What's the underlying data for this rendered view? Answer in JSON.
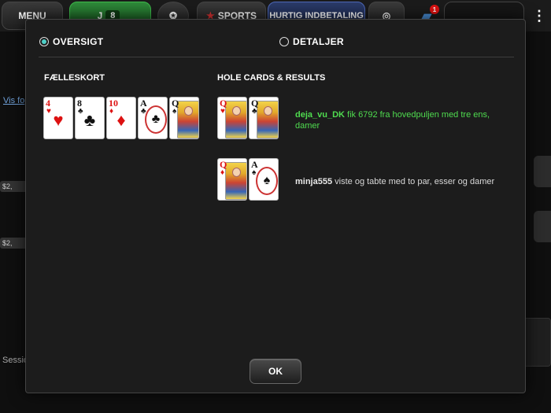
{
  "topbar": {
    "menu_label": "MENU",
    "hands_count": "8",
    "sports_label": "SPORTS",
    "quick_deposit_label": "HURTIG INDBETALING",
    "bag_badge": "1",
    "more_icon": "vertical-dots-icon"
  },
  "background": {
    "link_text": "Vis fo",
    "session_label": "Session",
    "chips": [
      "$2,",
      "$2,"
    ]
  },
  "modal": {
    "tabs": [
      {
        "label": "OVERSIGT",
        "selected": true
      },
      {
        "label": "DETALJER",
        "selected": false
      }
    ],
    "board_heading": "FÆLLESKORT",
    "hole_heading": "HOLE CARDS & RESULTS",
    "board_cards": [
      {
        "rank": "4",
        "suit": "♥",
        "color": "red"
      },
      {
        "rank": "8",
        "suit": "♣",
        "color": "black"
      },
      {
        "rank": "10",
        "suit": "♦",
        "color": "red"
      },
      {
        "rank": "A",
        "suit": "♣",
        "color": "black"
      },
      {
        "rank": "Q",
        "suit": "♠",
        "color": "black"
      }
    ],
    "hands": [
      {
        "player": "deja_vu_DK",
        "result": " fik 6792 fra hovedpuljen med tre ens, damer",
        "winner": true,
        "cards": [
          {
            "rank": "Q",
            "suit": "♥",
            "color": "red"
          },
          {
            "rank": "Q",
            "suit": "♣",
            "color": "black"
          }
        ]
      },
      {
        "player": "minja555",
        "result": " viste og tabte med to par, esser og damer",
        "winner": false,
        "cards": [
          {
            "rank": "Q",
            "suit": "♦",
            "color": "red"
          },
          {
            "rank": "A",
            "suit": "♠",
            "color": "black"
          }
        ]
      }
    ],
    "ok_label": "OK"
  },
  "colors": {
    "winner": "#4fdc4f",
    "radio_selected": "#4fd0c8",
    "red_suit": "#dd1111"
  }
}
